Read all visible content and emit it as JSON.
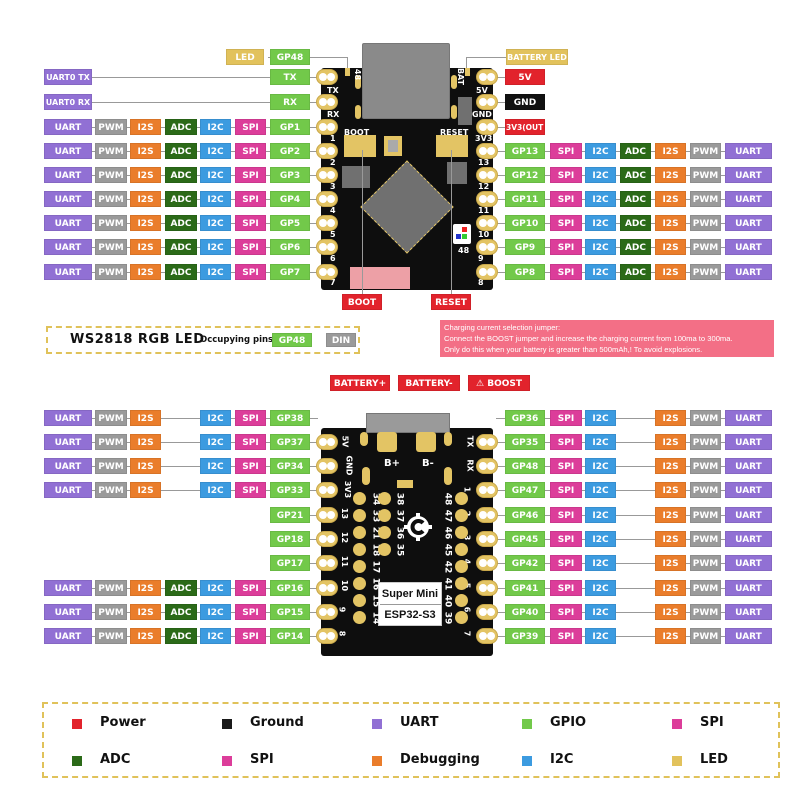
{
  "colors": {
    "uart": "#9170d4",
    "pwm": "#9a9a9a",
    "i2s": "#ea7d2b",
    "adc": "#2b6a18",
    "i2c": "#3c9be0",
    "spi": "#dc3d9a",
    "gpio": "#72c94a",
    "power": "#e2232c",
    "ground": "#111111",
    "led": "#e2c25c",
    "warning": "#f36f86"
  },
  "top_board": {
    "led_label": "LED",
    "led_pin": "GP48",
    "battery_led_label": "BATTERY LED",
    "left_special": [
      {
        "func": "UART0 TX",
        "pin": "TX"
      },
      {
        "func": "UART0 RX",
        "pin": "RX"
      }
    ],
    "left_rows": [
      {
        "pin": "GP1",
        "funcs": [
          "UART",
          "PWM",
          "I2S",
          "ADC",
          "I2C",
          "SPI"
        ]
      },
      {
        "pin": "GP2",
        "funcs": [
          "UART",
          "PWM",
          "I2S",
          "ADC",
          "I2C",
          "SPI"
        ]
      },
      {
        "pin": "GP3",
        "funcs": [
          "UART",
          "PWM",
          "I2S",
          "ADC",
          "I2C",
          "SPI"
        ]
      },
      {
        "pin": "GP4",
        "funcs": [
          "UART",
          "PWM",
          "I2S",
          "ADC",
          "I2C",
          "SPI"
        ]
      },
      {
        "pin": "GP5",
        "funcs": [
          "UART",
          "PWM",
          "I2S",
          "ADC",
          "I2C",
          "SPI"
        ]
      },
      {
        "pin": "GP6",
        "funcs": [
          "UART",
          "PWM",
          "I2S",
          "ADC",
          "I2C",
          "SPI"
        ]
      },
      {
        "pin": "GP7",
        "funcs": [
          "UART",
          "PWM",
          "I2S",
          "ADC",
          "I2C",
          "SPI"
        ]
      }
    ],
    "right_power": [
      {
        "label": "5V",
        "kind": "pwr"
      },
      {
        "label": "GND",
        "kind": "gnd"
      },
      {
        "label": "3V3(OUT)",
        "kind": "pwr"
      }
    ],
    "right_rows": [
      {
        "pin": "GP13",
        "funcs": [
          "SPI",
          "I2C",
          "ADC",
          "I2S",
          "PWM",
          "UART"
        ]
      },
      {
        "pin": "GP12",
        "funcs": [
          "SPI",
          "I2C",
          "ADC",
          "I2S",
          "PWM",
          "UART"
        ]
      },
      {
        "pin": "GP11",
        "funcs": [
          "SPI",
          "I2C",
          "ADC",
          "I2S",
          "PWM",
          "UART"
        ]
      },
      {
        "pin": "GP10",
        "funcs": [
          "SPI",
          "I2C",
          "ADC",
          "I2S",
          "PWM",
          "UART"
        ]
      },
      {
        "pin": "GP9",
        "funcs": [
          "SPI",
          "I2C",
          "ADC",
          "I2S",
          "PWM",
          "UART"
        ]
      },
      {
        "pin": "GP8",
        "funcs": [
          "SPI",
          "I2C",
          "ADC",
          "I2S",
          "PWM",
          "UART"
        ]
      }
    ],
    "silk": {
      "pin48": "48",
      "bat": "BAT",
      "tx": "TX",
      "rx": "RX",
      "boot": "BOOT",
      "reset": "RESET",
      "v5": "5V",
      "gnd": "GND",
      "v33": "3V3",
      "left_nums": [
        "1",
        "2",
        "3",
        "4",
        "5",
        "6",
        "7"
      ],
      "right_nums": [
        "13",
        "12",
        "11",
        "10",
        "9",
        "8"
      ],
      "led48": "48"
    },
    "boot_button": "BOOT",
    "reset_button": "RESET"
  },
  "rgb_led": {
    "title": "WS2818 RGB LED",
    "subtitle": "Occupying pins",
    "pin": "GP48",
    "signal": "DIN"
  },
  "warning": {
    "line1": "Charging current selection jumper:",
    "line2": "Connect the BOOST jumper and increase the charging current from 100ma to 300ma.",
    "line3": "Only do this when your battery is greater than 500mAh,! To avoid explosions."
  },
  "bottom_board": {
    "battery_plus": "BATTERY+",
    "battery_minus": "BATTERY-",
    "boost": "BOOST",
    "boost_icon": "warning-triangle-icon",
    "left_rows": [
      {
        "pin": "GP38",
        "funcs": [
          "UART",
          "PWM",
          "I2S",
          "",
          "I2C",
          "SPI"
        ]
      },
      {
        "pin": "GP37",
        "funcs": [
          "UART",
          "PWM",
          "I2S",
          "",
          "I2C",
          "SPI"
        ]
      },
      {
        "pin": "GP34",
        "funcs": [
          "UART",
          "PWM",
          "I2S",
          "",
          "I2C",
          "SPI"
        ]
      },
      {
        "pin": "GP33",
        "funcs": [
          "UART",
          "PWM",
          "I2S",
          "",
          "I2C",
          "SPI"
        ]
      },
      {
        "pin": "GP21",
        "funcs": []
      },
      {
        "pin": "GP18",
        "funcs": []
      },
      {
        "pin": "GP17",
        "funcs": []
      },
      {
        "pin": "GP16",
        "funcs": [
          "UART",
          "PWM",
          "I2S",
          "ADC",
          "I2C",
          "SPI"
        ]
      },
      {
        "pin": "GP15",
        "funcs": [
          "UART",
          "PWM",
          "I2S",
          "ADC",
          "I2C",
          "SPI"
        ]
      },
      {
        "pin": "GP14",
        "funcs": [
          "UART",
          "PWM",
          "I2S",
          "ADC",
          "I2C",
          "SPI"
        ]
      }
    ],
    "right_rows": [
      {
        "pin": "GP36",
        "funcs": [
          "SPI",
          "I2C",
          "",
          "I2S",
          "PWM",
          "UART"
        ]
      },
      {
        "pin": "GP35",
        "funcs": [
          "SPI",
          "I2C",
          "",
          "I2S",
          "PWM",
          "UART"
        ]
      },
      {
        "pin": "GP48",
        "funcs": [
          "SPI",
          "I2C",
          "",
          "I2S",
          "PWM",
          "UART"
        ]
      },
      {
        "pin": "GP47",
        "funcs": [
          "SPI",
          "I2C",
          "",
          "I2S",
          "PWM",
          "UART"
        ]
      },
      {
        "pin": "GP46",
        "funcs": [
          "SPI",
          "I2C",
          "",
          "I2S",
          "PWM",
          "UART"
        ]
      },
      {
        "pin": "GP45",
        "funcs": [
          "SPI",
          "I2C",
          "",
          "I2S",
          "PWM",
          "UART"
        ]
      },
      {
        "pin": "GP42",
        "funcs": [
          "SPI",
          "I2C",
          "",
          "I2S",
          "PWM",
          "UART"
        ]
      },
      {
        "pin": "GP41",
        "funcs": [
          "SPI",
          "I2C",
          "",
          "I2S",
          "PWM",
          "UART"
        ]
      },
      {
        "pin": "GP40",
        "funcs": [
          "SPI",
          "I2C",
          "",
          "I2S",
          "PWM",
          "UART"
        ]
      },
      {
        "pin": "GP39",
        "funcs": [
          "SPI",
          "I2C",
          "",
          "I2S",
          "PWM",
          "UART"
        ]
      }
    ],
    "silk": {
      "left_edge": [
        "5V",
        "GND",
        "3V3",
        "13",
        "12",
        "11",
        "10",
        "9",
        "8"
      ],
      "right_edge": [
        "TX",
        "RX",
        "1",
        "2",
        "3",
        "4",
        "5",
        "6",
        "7"
      ],
      "inner_left": [
        "34",
        "33",
        "21",
        "18",
        "17",
        "16",
        "15",
        "14"
      ],
      "inner_mid": [
        "38",
        "37",
        "36",
        "35"
      ],
      "inner_right": [
        "48",
        "47",
        "46",
        "45",
        "42",
        "41",
        "40",
        "39"
      ],
      "b_plus": "B+",
      "b_minus": "B-"
    },
    "name_line1": "Super Mini",
    "name_line2": "ESP32-S3"
  },
  "legend": [
    {
      "label": "Power",
      "color": "#e2232c"
    },
    {
      "label": "Ground",
      "color": "#1a1a1a"
    },
    {
      "label": "UART",
      "color": "#9170d4"
    },
    {
      "label": "GPIO",
      "color": "#72c94a"
    },
    {
      "label": "SPI",
      "color": "#dc3d9a"
    },
    {
      "label": "ADC",
      "color": "#2b6a18"
    },
    {
      "label": "SPI",
      "color": "#dc3d9a"
    },
    {
      "label": "Debugging",
      "color": "#ea7d2b"
    },
    {
      "label": "I2C",
      "color": "#3c9be0"
    },
    {
      "label": "LED",
      "color": "#e2c25c"
    }
  ]
}
